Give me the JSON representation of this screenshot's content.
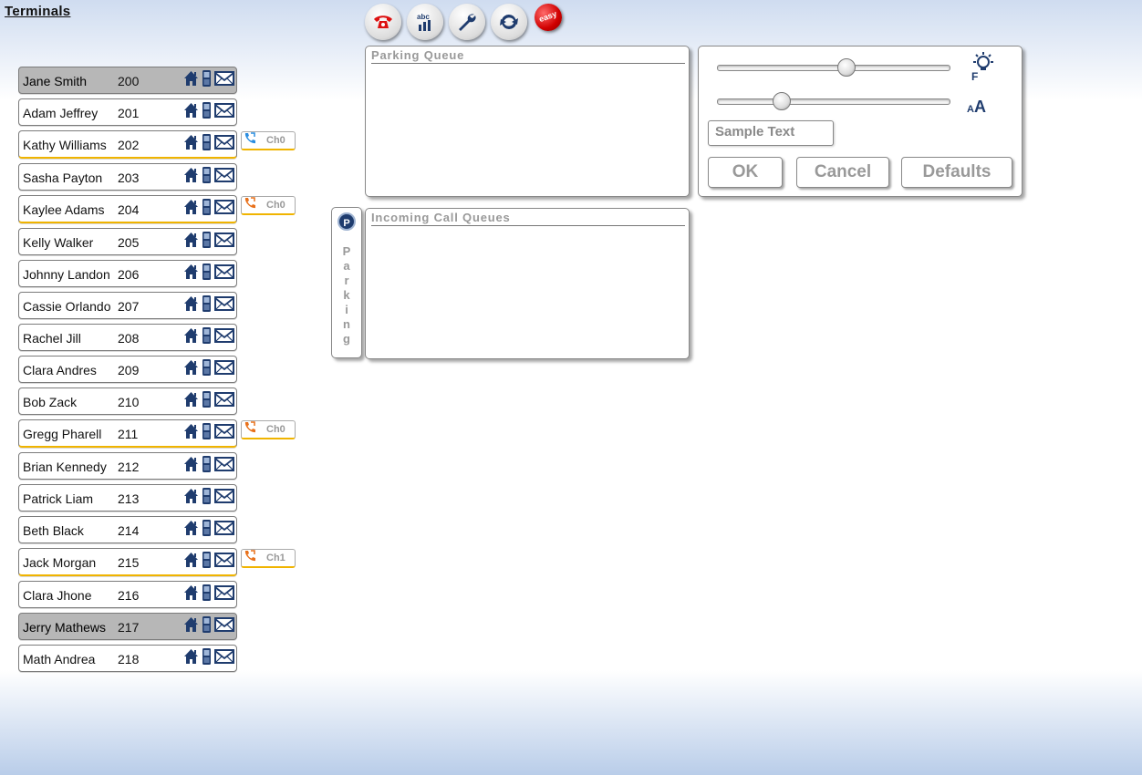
{
  "header": {
    "title": "Terminals"
  },
  "toolbar": {
    "buttons": [
      "phone-icon",
      "abc-chart-icon",
      "wrench-icon",
      "refresh-icon"
    ],
    "easy_label": "easy"
  },
  "terminals": [
    {
      "name": "Jane Smith",
      "ext": "200",
      "selected": true
    },
    {
      "name": "Adam Jeffrey",
      "ext": "201"
    },
    {
      "name": "Kathy Williams",
      "ext": "202",
      "channel": "Ch0",
      "channel_color": "#2a8de0"
    },
    {
      "name": "Sasha Payton",
      "ext": "203"
    },
    {
      "name": "Kaylee Adams",
      "ext": "204",
      "channel": "Ch0",
      "channel_color": "#e8701a"
    },
    {
      "name": "Kelly Walker",
      "ext": "205"
    },
    {
      "name": "Johnny Landon",
      "ext": "206"
    },
    {
      "name": "Cassie Orlando",
      "ext": "207"
    },
    {
      "name": "Rachel Jill",
      "ext": "208"
    },
    {
      "name": "Clara Andres",
      "ext": "209"
    },
    {
      "name": "Bob Zack",
      "ext": "210"
    },
    {
      "name": "Gregg Pharell",
      "ext": "211",
      "channel": "Ch0",
      "channel_color": "#e8701a"
    },
    {
      "name": "Brian Kennedy",
      "ext": "212"
    },
    {
      "name": "Patrick Liam",
      "ext": "213"
    },
    {
      "name": "Beth Black",
      "ext": "214"
    },
    {
      "name": "Jack Morgan",
      "ext": "215",
      "channel": "Ch1",
      "channel_color": "#e8701a"
    },
    {
      "name": "Clara Jhone",
      "ext": "216"
    },
    {
      "name": "Jerry Mathews",
      "ext": "217",
      "selected": true
    },
    {
      "name": "Math Andrea",
      "ext": "218"
    }
  ],
  "parking_queue": {
    "title": "Parking Queue"
  },
  "incoming": {
    "title": "Incoming Call Queues"
  },
  "parking_tab": {
    "badge": "P",
    "label": "Parking"
  },
  "settings": {
    "brightness_value": 0.55,
    "font_size_value": 0.25,
    "brightness_icon_label": "F",
    "font_icon_small": "A",
    "font_icon_large": "A",
    "sample_text": "Sample Text",
    "ok_label": "OK",
    "cancel_label": "Cancel",
    "defaults_label": "Defaults"
  },
  "colors": {
    "accent_navy": "#1f3c6e",
    "call_border": "#f0b400"
  }
}
